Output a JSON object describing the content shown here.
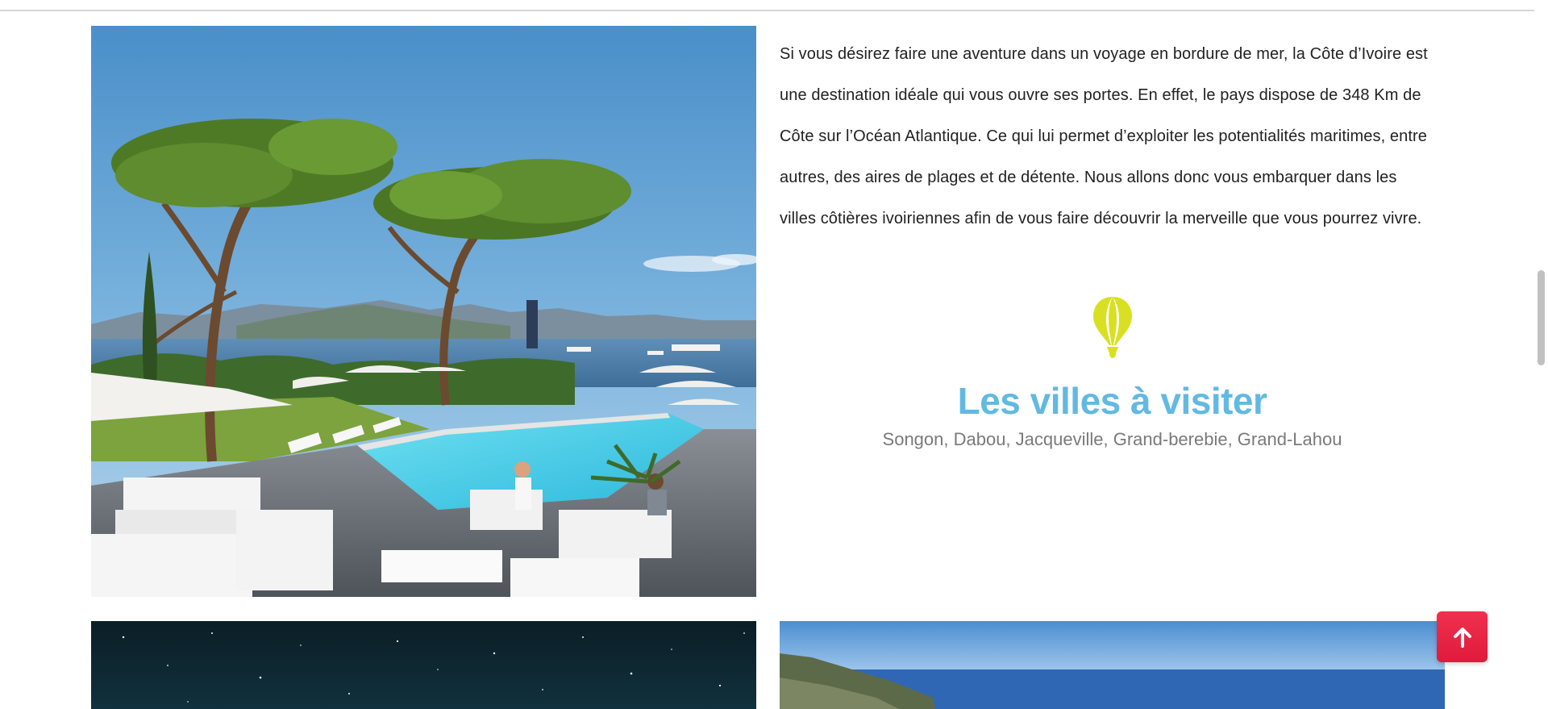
{
  "intro": {
    "paragraph": "Si vous désirez faire une aventure dans un voyage en bordure de mer, la Côte d’Ivoire est une destination idéale qui vous ouvre ses portes. En effet, le pays dispose de 348 Km de Côte sur l’Océan Atlantique. Ce qui lui permet d’exploiter les potentialités maritimes, entre autres, des aires de plages et de détente. Nous allons donc vous embarquer dans les villes côtières ivoiriennes afin de vous faire découvrir la merveille que vous pourrez vivre."
  },
  "section": {
    "icon": "hot-air-balloon-icon",
    "title": "Les villes à visiter",
    "subtitle": "Songon, Dabou, Jacqueville, Grand-berebie, Grand-Lahou"
  },
  "images": [
    {
      "name": "resort-pool-photo",
      "subject": "seaside resort with pool, umbrella pines and bay"
    },
    {
      "name": "night-sky-photo",
      "subject": "starry night sky"
    },
    {
      "name": "coastline-photo",
      "subject": "rocky coastline over the sea"
    }
  ],
  "scroll_top": {
    "icon": "arrow-up-icon"
  },
  "colors": {
    "title": "#62b9e2",
    "subtitle": "#7a7a7a",
    "body_text": "#222222",
    "balloon": "#d9e021",
    "scroll_top_button": "#e8213f"
  }
}
